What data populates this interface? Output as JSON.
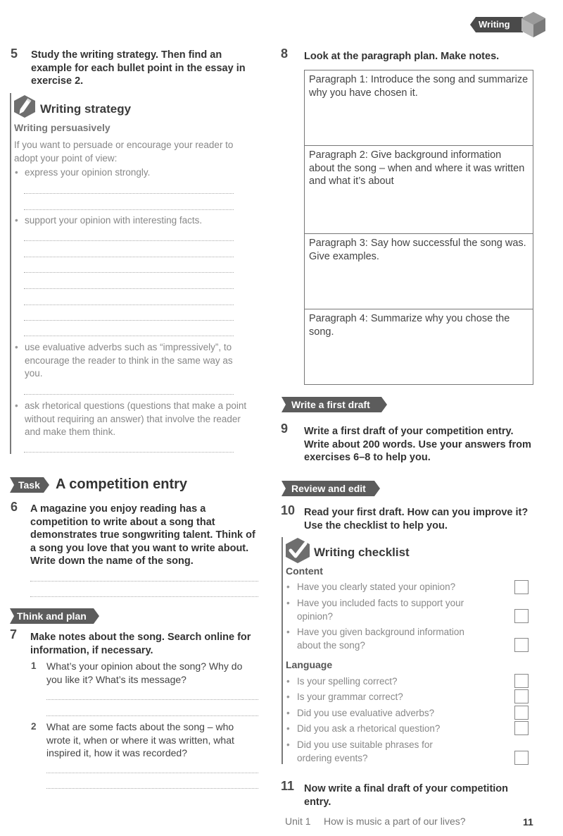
{
  "header": {
    "tab_label": "Writing"
  },
  "exercise5": {
    "number": "5",
    "text": "Study the writing strategy. Then find an example for each bullet point in the essay in exercise 2.",
    "strategy_box": {
      "icon": "pencil-icon",
      "title": "Writing strategy",
      "subtitle": "Writing persuasively",
      "intro": "If you want to persuade or encourage your reader to adopt your point of view:",
      "bullets": [
        "express your opinion strongly.",
        "support your opinion with interesting facts.",
        "use evaluative adverbs such as “impressively”, to encourage the reader to think in the same way as you.",
        "ask rhetorical questions (questions that make a point without requiring an answer) that involve the reader and make them think."
      ]
    }
  },
  "task": {
    "tag": "Task",
    "title": "A competition entry"
  },
  "exercise6": {
    "number": "6",
    "text": "A magazine you enjoy reading has a competition to write about a song that demonstrates true songwriting talent. Think of a song you love that you want to write about. Write down the name of the song."
  },
  "think_and_plan": {
    "tag": "Think and plan"
  },
  "exercise7": {
    "number": "7",
    "text": "Make notes about the song. Search online for information, if necessary.",
    "questions": [
      {
        "num": "1",
        "text": "What’s your opinion about the song? Why do you like it? What’s its message?"
      },
      {
        "num": "2",
        "text": "What are some facts about the song – who wrote it, when or where it was written, what inspired it, how it was recorded?"
      }
    ]
  },
  "exercise8": {
    "number": "8",
    "text": "Look at the paragraph plan. Make notes.",
    "plan": [
      "Paragraph 1: Introduce the song and summarize why you have chosen it.",
      "Paragraph 2: Give background information about the song – when and where it was written and what it’s about",
      "Paragraph 3: Say how successful the song was. Give examples.",
      "Paragraph 4: Summarize why you chose the song."
    ]
  },
  "first_draft": {
    "tag": "Write a first draft"
  },
  "exercise9": {
    "number": "9",
    "text": "Write a first draft of your competition entry. Write about 200 words. Use your answers from exercises 6–8 to help you."
  },
  "review": {
    "tag": "Review and edit"
  },
  "exercise10": {
    "number": "10",
    "text": "Read your first draft. How can you improve it? Use the checklist to help you."
  },
  "checklist": {
    "icon": "checkmark-icon",
    "title": "Writing checklist",
    "content_heading": "Content",
    "content_items": [
      "Have you clearly stated your opinion?",
      "Have you included facts to support your opinion?",
      "Have you given background information about the song?"
    ],
    "language_heading": "Language",
    "language_items": [
      "Is your spelling correct?",
      "Is your grammar correct?",
      "Did you use evaluative adverbs?",
      "Did you ask a rhetorical question?",
      "Did you use suitable phrases for ordering events?"
    ]
  },
  "exercise11": {
    "number": "11",
    "text": "Now write a final draft of your competition entry."
  },
  "footer": {
    "unit": "Unit 1",
    "unit_title": "How is music a part of our lives?",
    "page_number": "11"
  }
}
